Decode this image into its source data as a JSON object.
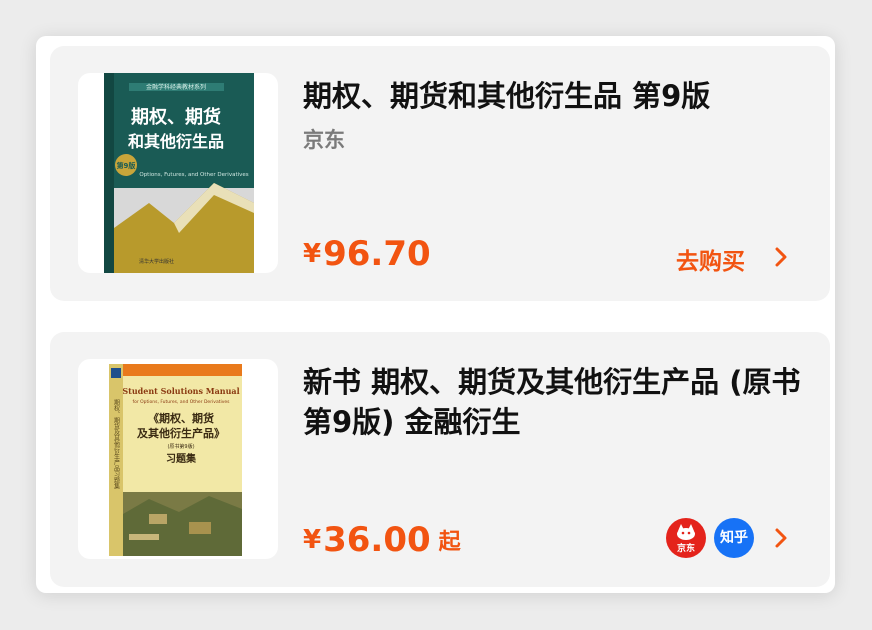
{
  "products": [
    {
      "title": "期权、期货和其他衍生品 第9版",
      "source": "京东",
      "price_symbol": "¥",
      "price": "96.70",
      "action_label": "去购买",
      "cover": {
        "series": "金融学科经典教材系列",
        "title_line1": "期权、期货",
        "title_line2": "和其他衍生品",
        "edition_badge": "第9版",
        "english_title": "Options, Futures, and Other Derivatives",
        "publisher": "清华大学出版社",
        "colors": {
          "top": "#1a5b55",
          "gold": "#b89a2c",
          "grey": "#d8d8d8"
        }
      }
    },
    {
      "title": "新书 期权、期货及其他衍生产品 (原书第9版) 金融衍生",
      "source": "",
      "price_symbol": "¥",
      "price": "36.00",
      "price_suffix": "起",
      "stores": [
        {
          "name": "京东",
          "icon": "jd-dog-icon",
          "color": "#e4231b"
        },
        {
          "name": "知乎",
          "icon": "zhihu-icon",
          "color": "#1772f6"
        }
      ],
      "cover": {
        "english_title": "Student Solutions Manual",
        "english_subtitle": "for Options, Futures, and Other Derivatives",
        "title_line1": "《期权、期货",
        "title_line2": "及其他衍生产品》",
        "edition": "(原书第9版)",
        "subtitle": "习题集",
        "spine_text": "期权、期货及其他衍生产品习题集",
        "colors": {
          "bg": "#f2e8a6",
          "orange": "#e97a1c",
          "painting": "#7a7a45"
        }
      }
    }
  ],
  "colors": {
    "accent": "#f25411",
    "card_bg": "#f3f3f3",
    "text": "#111111",
    "muted": "#7a7a7a"
  }
}
